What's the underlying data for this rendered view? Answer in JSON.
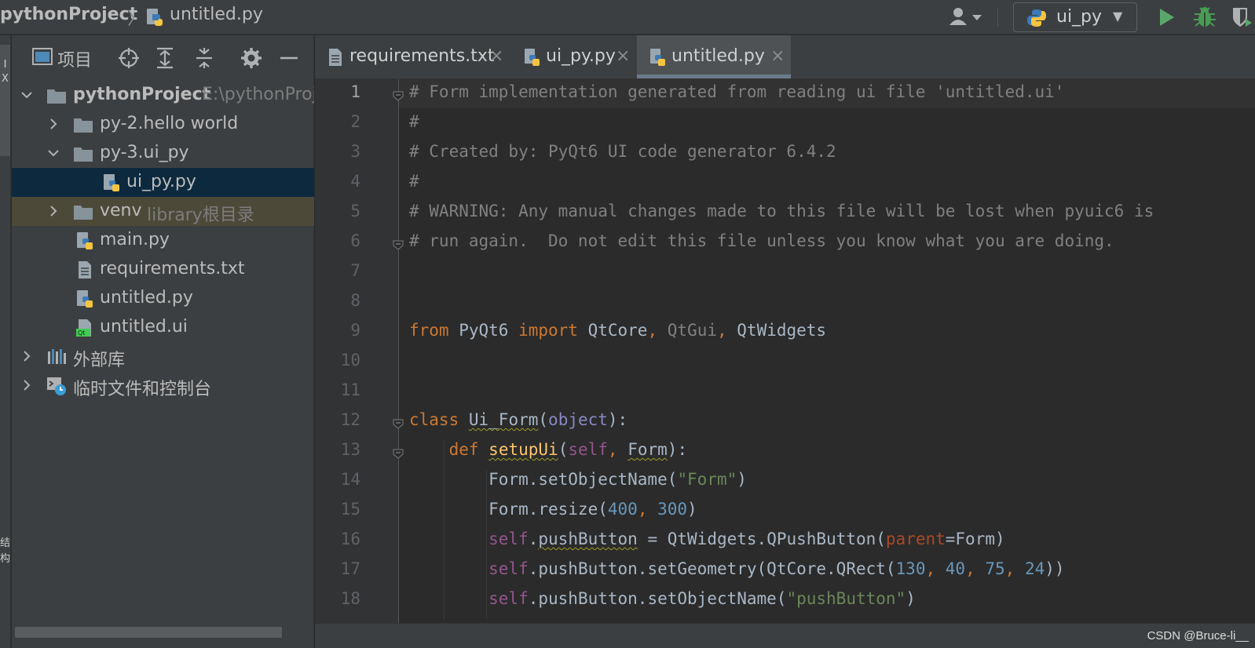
{
  "navbar": {
    "project": "pythonProject",
    "separator": "〉",
    "file": "untitled.py",
    "run_config": "ui_py",
    "run_config_caret": "▼"
  },
  "stripe": {
    "top_marks": [
      "I",
      "X"
    ],
    "bottom_marks": [
      "结",
      "构"
    ]
  },
  "project_panel": {
    "title": "项目",
    "tree": [
      {
        "label": "pythonProject",
        "hint": "E:\\pythonProj",
        "bold": true,
        "icon": "folder-icon",
        "arrow": "down"
      },
      {
        "label": "py-2.hello world",
        "icon": "folder-icon",
        "arrow": "right"
      },
      {
        "label": "py-3.ui_py",
        "icon": "folder-icon",
        "arrow": "down"
      },
      {
        "label": "ui_py.py",
        "icon": "python-file-icon",
        "selected": true
      },
      {
        "label": "venv",
        "hint": "library根目录",
        "icon": "folder-icon",
        "arrow": "right",
        "excluded": true
      },
      {
        "label": "main.py",
        "icon": "python-file-icon"
      },
      {
        "label": "requirements.txt",
        "icon": "text-file-icon"
      },
      {
        "label": "untitled.py",
        "icon": "python-file-icon"
      },
      {
        "label": "untitled.ui",
        "icon": "qt-file-icon"
      },
      {
        "label": "外部库",
        "icon": "library-icon",
        "arrow": "right"
      },
      {
        "label": "临时文件和控制台",
        "icon": "scratch-icon",
        "arrow": "right"
      }
    ]
  },
  "tabs": [
    {
      "label": "requirements.txt",
      "close": "×",
      "icon": "text-file-icon"
    },
    {
      "label": "ui_py.py",
      "close": "×",
      "icon": "python-file-icon"
    },
    {
      "label": "untitled.py",
      "close": "×",
      "icon": "python-file-icon",
      "active": true
    }
  ],
  "editor": {
    "line_numbers": [
      "1",
      "2",
      "3",
      "4",
      "5",
      "6",
      "7",
      "8",
      "9",
      "10",
      "11",
      "12",
      "13",
      "14",
      "15",
      "16",
      "17",
      "18"
    ],
    "lines": [
      [
        {
          "t": "# Form implementation generated from reading ui file 'untitled.ui'",
          "c": "com"
        }
      ],
      [
        {
          "t": "#",
          "c": "com"
        }
      ],
      [
        {
          "t": "# Created by: PyQt6 UI code generator 6.4.2",
          "c": "com"
        }
      ],
      [
        {
          "t": "#",
          "c": "com"
        }
      ],
      [
        {
          "t": "# WARNING: Any manual changes made to this file will be lost when pyuic6 is",
          "c": "com"
        }
      ],
      [
        {
          "t": "# run again.  Do not edit this file unless you know what you are doing.",
          "c": "com"
        }
      ],
      [],
      [],
      [
        {
          "t": "from",
          "c": "kw"
        },
        {
          "t": " PyQt6 ",
          "c": "plain"
        },
        {
          "t": "import",
          "c": "kw"
        },
        {
          "t": " QtCore",
          "c": "plain"
        },
        {
          "t": ", ",
          "c": "punc"
        },
        {
          "t": "QtGui",
          "c": "grey"
        },
        {
          "t": ", ",
          "c": "punc"
        },
        {
          "t": "QtWidgets",
          "c": "plain"
        }
      ],
      [],
      [],
      [
        {
          "t": "class",
          "c": "kw"
        },
        {
          "t": " ",
          "c": "plain"
        },
        {
          "t": "Ui_Form",
          "c": "plain",
          "u": "wavy"
        },
        {
          "t": "(",
          "c": "plain"
        },
        {
          "t": "object",
          "c": "builtin"
        },
        {
          "t": "):",
          "c": "plain"
        }
      ],
      [
        {
          "t": "    ",
          "c": "plain"
        },
        {
          "t": "def",
          "c": "kw"
        },
        {
          "t": " ",
          "c": "plain"
        },
        {
          "t": "setupUi",
          "c": "fn",
          "u": "wavy"
        },
        {
          "t": "(",
          "c": "plain"
        },
        {
          "t": "self",
          "c": "self"
        },
        {
          "t": ", ",
          "c": "punc"
        },
        {
          "t": "Form",
          "c": "plain",
          "u": "wavy"
        },
        {
          "t": "):",
          "c": "plain"
        }
      ],
      [
        {
          "t": "        Form.setObjectName(",
          "c": "plain"
        },
        {
          "t": "\"Form\"",
          "c": "str"
        },
        {
          "t": ")",
          "c": "plain"
        }
      ],
      [
        {
          "t": "        Form.resize(",
          "c": "plain"
        },
        {
          "t": "400",
          "c": "num"
        },
        {
          "t": ", ",
          "c": "punc"
        },
        {
          "t": "300",
          "c": "num"
        },
        {
          "t": ")",
          "c": "plain"
        }
      ],
      [
        {
          "t": "        ",
          "c": "plain"
        },
        {
          "t": "self",
          "c": "self"
        },
        {
          "t": ".",
          "c": "plain"
        },
        {
          "t": "pushButton",
          "c": "plain",
          "u": "wavy"
        },
        {
          "t": " = QtWidgets.QPushButton(",
          "c": "plain"
        },
        {
          "t": "parent",
          "c": "param"
        },
        {
          "t": "=Form)",
          "c": "plain"
        }
      ],
      [
        {
          "t": "        ",
          "c": "plain"
        },
        {
          "t": "self",
          "c": "self"
        },
        {
          "t": ".pushButton.setGeometry(QtCore.QRect(",
          "c": "plain"
        },
        {
          "t": "130",
          "c": "num"
        },
        {
          "t": ", ",
          "c": "punc"
        },
        {
          "t": "40",
          "c": "num"
        },
        {
          "t": ", ",
          "c": "punc"
        },
        {
          "t": "75",
          "c": "num"
        },
        {
          "t": ", ",
          "c": "punc"
        },
        {
          "t": "24",
          "c": "num"
        },
        {
          "t": "))",
          "c": "plain"
        }
      ],
      [
        {
          "t": "        ",
          "c": "plain"
        },
        {
          "t": "self",
          "c": "self"
        },
        {
          "t": ".pushButton.setObjectName(",
          "c": "plain"
        },
        {
          "t": "\"pushButton\"",
          "c": "str"
        },
        {
          "t": ")",
          "c": "plain"
        }
      ]
    ]
  },
  "statusbar": {
    "watermark": "CSDN @Bruce-li__"
  },
  "colors": {
    "selected_row": "#0d293e",
    "excluded_row": "#4d4939",
    "run_green": "#59a869",
    "debug_green": "#499c54"
  }
}
